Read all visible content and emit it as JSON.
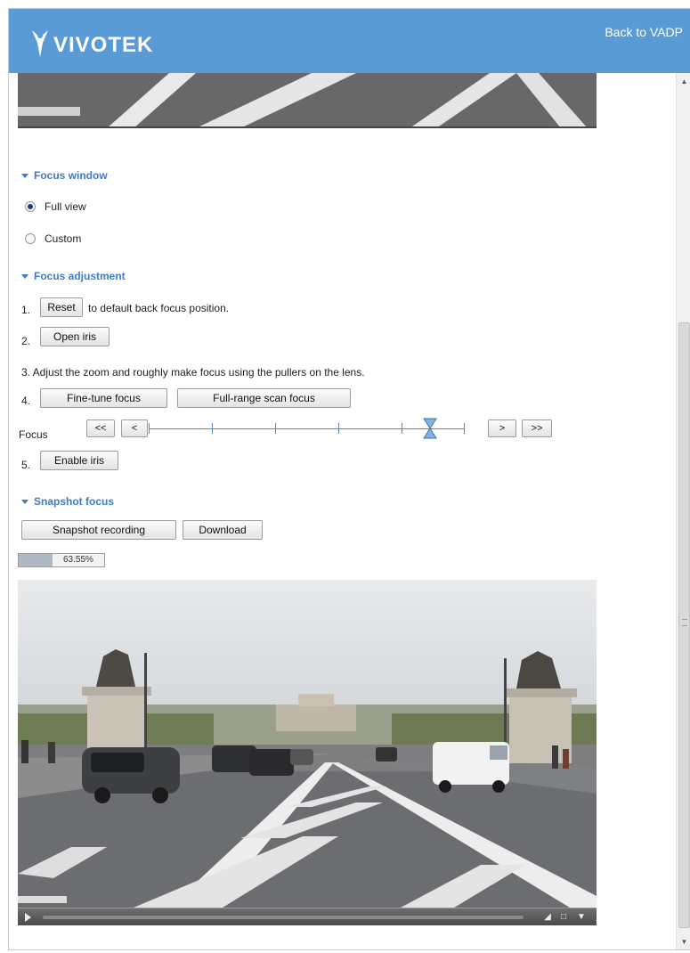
{
  "header": {
    "logo_text": "VIVOTEK",
    "back_link": "Back to VADP",
    "brand_color": "#5b9bd5"
  },
  "focus_window": {
    "title": "Focus window",
    "options": [
      {
        "label": "Full view",
        "checked": true
      },
      {
        "label": "Custom",
        "checked": false
      }
    ]
  },
  "focus_adjustment": {
    "title": "Focus adjustment",
    "steps": {
      "s1_num": "1.",
      "reset_button": "Reset",
      "s1_text": "to default back focus position.",
      "s2_num": "2.",
      "open_iris_button": "Open iris",
      "s3_text": "3.  Adjust the zoom and roughly make focus using the pullers on the lens.",
      "s4_num": "4.",
      "fine_tune_button": "Fine-tune focus",
      "full_range_button": "Full-range scan focus",
      "focus_label": "Focus",
      "s5_num": "5.",
      "enable_iris_button": "Enable iris"
    },
    "slider": {
      "step_back_far": "<<",
      "step_back": "<",
      "step_forward": ">",
      "step_forward_far": ">>",
      "position_fraction": 0.89
    }
  },
  "snapshot_focus": {
    "title": "Snapshot focus",
    "record_button": "Snapshot recording",
    "download_button": "Download",
    "progress_value": "63.55%",
    "progress_fraction": 0.4
  },
  "player": {
    "icons": [
      "play-icon",
      "volume-icon",
      "fullscreen-icon",
      "menu-icon"
    ]
  }
}
